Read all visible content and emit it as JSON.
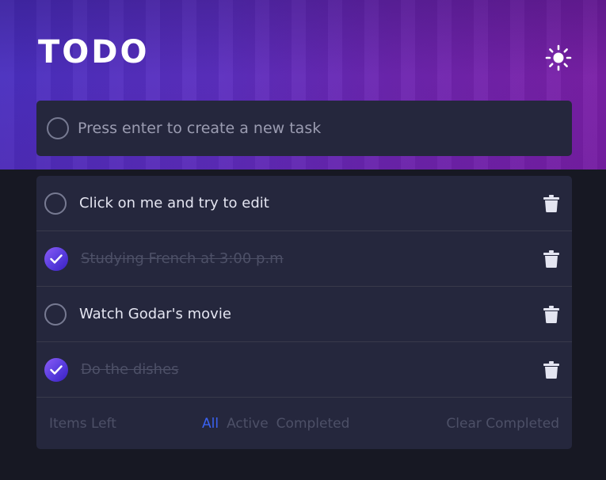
{
  "app": {
    "title": "TODO"
  },
  "new_task": {
    "placeholder": "Press enter to create a new task"
  },
  "todos": [
    {
      "text": "Click on me and try to edit",
      "completed": false
    },
    {
      "text": "Studying French at 3:00 p.m",
      "completed": true
    },
    {
      "text": "Watch Godar's movie",
      "completed": false
    },
    {
      "text": "Do the dishes",
      "completed": true
    }
  ],
  "footer": {
    "items_left": "Items Left",
    "filters": [
      "All",
      "Active",
      "Completed"
    ],
    "active_filter": "All",
    "clear_label": "Clear Completed"
  },
  "icons": {
    "theme_toggle": "sun-icon",
    "delete": "trash-icon",
    "checked": "check-icon"
  },
  "colors": {
    "accent": "#3a62f2",
    "card": "#25273d",
    "background": "#171823",
    "check_gradient_start": "#8d5cf6",
    "check_gradient_end": "#3a1fc0"
  }
}
